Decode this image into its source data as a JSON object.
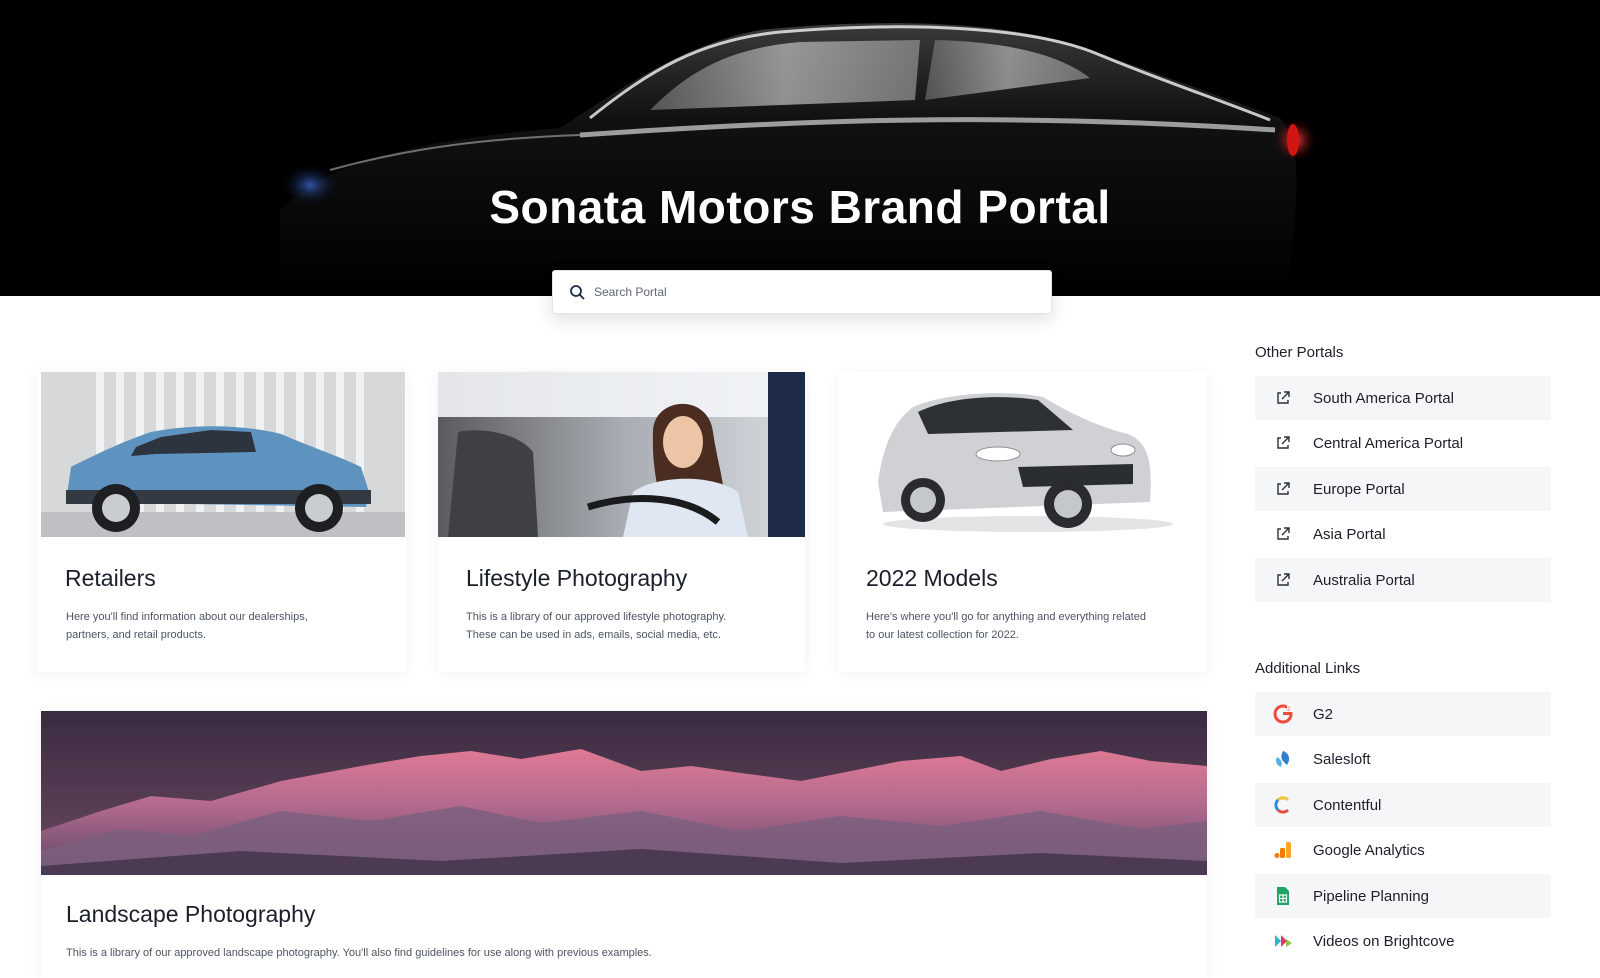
{
  "hero": {
    "title": "Sonata Motors Brand Portal"
  },
  "search": {
    "placeholder": "Search Portal",
    "icon": "search-icon"
  },
  "cards": [
    {
      "title": "Retailers",
      "description_line1": "Here you'll find information about our dealerships,",
      "description_line2": "partners, and retail products.",
      "image": "blue-suv-photo"
    },
    {
      "title": "Lifestyle Photography",
      "description_line1": "This is a library of our approved lifestyle photography.",
      "description_line2": "These can be used in ads, emails, social media, etc.",
      "image": "woman-driving-photo"
    },
    {
      "title": "2022 Models",
      "description_line1": "Here's where you'll go for anything and everything related",
      "description_line2": "to our latest collection for 2022.",
      "image": "silver-hatchback-photo"
    },
    {
      "title": "Landscape Photography",
      "description_line1": "This is a library of our approved landscape photography. You'll also find guidelines for use along with previous examples.",
      "image": "mountain-range-photo"
    }
  ],
  "other_portals": {
    "heading": "Other Portals",
    "icon": "external-link-icon",
    "items": [
      {
        "label": "South America Portal"
      },
      {
        "label": "Central America Portal"
      },
      {
        "label": "Europe Portal"
      },
      {
        "label": "Asia Portal"
      },
      {
        "label": "Australia Portal"
      }
    ]
  },
  "additional_links": {
    "heading": "Additional Links",
    "items": [
      {
        "label": "G2",
        "icon": "g2-logo-icon"
      },
      {
        "label": "Salesloft",
        "icon": "salesloft-logo-icon"
      },
      {
        "label": "Contentful",
        "icon": "contentful-logo-icon"
      },
      {
        "label": "Google Analytics",
        "icon": "google-analytics-logo-icon"
      },
      {
        "label": "Pipeline Planning",
        "icon": "google-sheets-icon"
      },
      {
        "label": "Videos on Brightcove",
        "icon": "brightcove-logo-icon"
      }
    ]
  },
  "colors": {
    "hero_background": "#000000",
    "row_shade": "#f5f6f8",
    "text": "#1b1f2a",
    "muted_text": "#4d5463"
  }
}
